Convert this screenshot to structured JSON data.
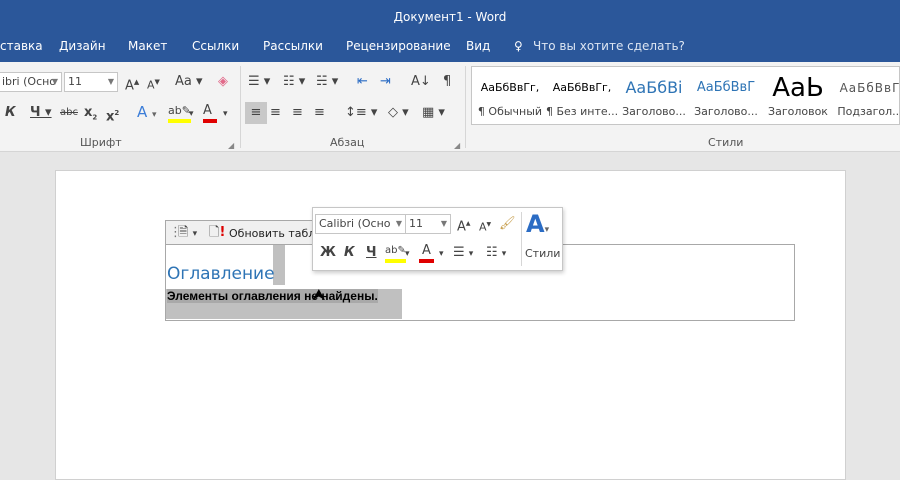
{
  "window": {
    "title": "Документ1 - Word"
  },
  "tabs": [
    "ставка",
    "Дизайн",
    "Макет",
    "Ссылки",
    "Рассылки",
    "Рецензирование",
    "Вид"
  ],
  "tell_me": {
    "placeholder": "Что вы хотите сделать?",
    "icon": "lightbulb-icon"
  },
  "ribbon": {
    "font": {
      "name": "ibri (Осно",
      "size": "11",
      "group_label": "Шрифт"
    },
    "paragraph": {
      "group_label": "Абзац"
    },
    "styles": {
      "group_label": "Стили",
      "items": [
        {
          "preview": "АаБбВвГг,",
          "name": "¶ Обычный"
        },
        {
          "preview": "АаБбВвГг,",
          "name": "¶ Без инте..."
        },
        {
          "preview": "АаБбВі",
          "name": "Заголово..."
        },
        {
          "preview": "АаБбВвГ",
          "name": "Заголово..."
        },
        {
          "preview": "АаЬ",
          "name": "Заголовок"
        },
        {
          "preview": "АаБбВвГ",
          "name": "Подзагол..."
        }
      ]
    },
    "colors": {
      "highlight": "#ffff00",
      "font_color": "#e00000",
      "accent": "#2b579a"
    }
  },
  "toc": {
    "update_label": "Обновить табл",
    "heading": "Оглавление",
    "message": "Элементы оглавления не найдены."
  },
  "mini_toolbar": {
    "font": "Calibri (Осно",
    "size": "11",
    "styles_label": "Стили"
  }
}
